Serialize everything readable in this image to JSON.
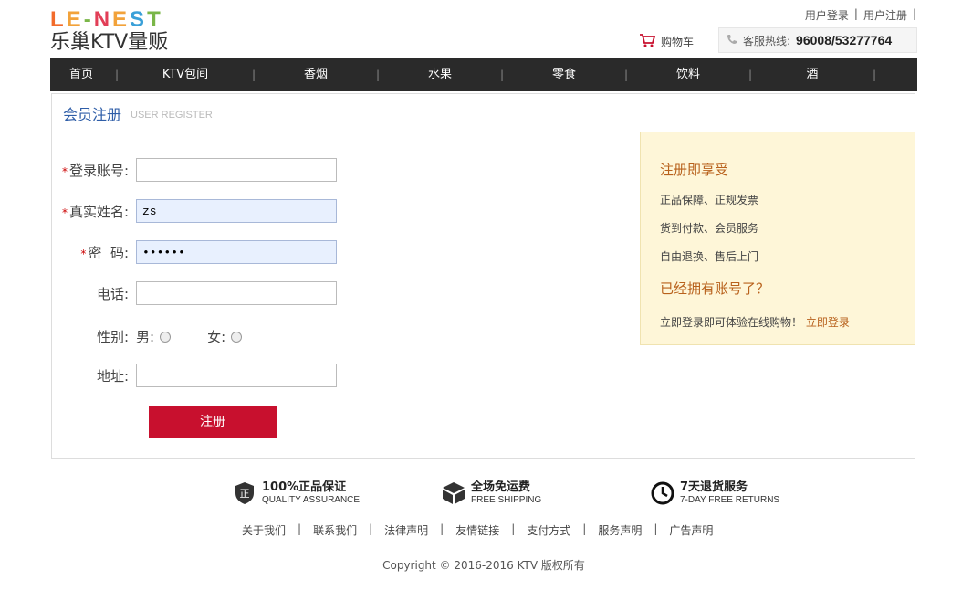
{
  "logo": {
    "top_letters": [
      "L",
      "E",
      "-",
      "N",
      "E",
      "S",
      "T"
    ],
    "top_colors": [
      "#f26b2b",
      "#f2a23a",
      "#7ab648",
      "#e23e57",
      "#f2a23a",
      "#3aa0d8",
      "#7ab648"
    ],
    "bottom_text": "乐巢KTV量贩"
  },
  "top_links": {
    "login": "用户登录",
    "register": "用户注册",
    "sep": "|"
  },
  "cart": {
    "label": "购物车",
    "icon": "cart-icon"
  },
  "hotline": {
    "label": "客服热线:",
    "number": "96008/53277764",
    "icon": "phone-icon"
  },
  "nav": {
    "items": [
      "首页",
      "KTV包间",
      "香烟",
      "水果",
      "零食",
      "饮料",
      "酒"
    ],
    "sep": "|"
  },
  "register": {
    "title_cn": "会员注册",
    "title_en": "USER REGISTER",
    "required_mark": "*",
    "fields": {
      "account": {
        "label": "登录账号:",
        "value": ""
      },
      "realname": {
        "label": "真实姓名:",
        "value": "zs"
      },
      "password": {
        "label": "密  码:",
        "value": "••••••"
      },
      "phone": {
        "label": "电话:",
        "value": ""
      },
      "gender": {
        "label": "性别:",
        "male": "男:",
        "female": "女:"
      },
      "address": {
        "label": "地址:",
        "value": ""
      }
    },
    "submit": "注册"
  },
  "side": {
    "heading1": "注册即享受",
    "benefits": [
      "正品保障、正规发票",
      "货到付款、会员服务",
      "自由退换、售后上门"
    ],
    "heading2": "已经拥有账号了？",
    "login_prompt": "立即登录即可体验在线购物！",
    "login_link": "立即登录"
  },
  "features": [
    {
      "title": "100%正品保证",
      "subtitle": "QUALITY ASSURANCE",
      "icon": "shield-icon"
    },
    {
      "title": "全场免运费",
      "subtitle": "FREE SHIPPING",
      "icon": "box-icon"
    },
    {
      "title": "7天退货服务",
      "subtitle": "7-DAY FREE RETURNS",
      "icon": "clock-icon"
    }
  ],
  "footer_links": [
    "关于我们",
    "联系我们",
    "法律声明",
    "友情链接",
    "支付方式",
    "服务声明",
    "广告声明"
  ],
  "footer_sep": "|",
  "copyright": "Copyright © 2016-2016 KTV 版权所有"
}
